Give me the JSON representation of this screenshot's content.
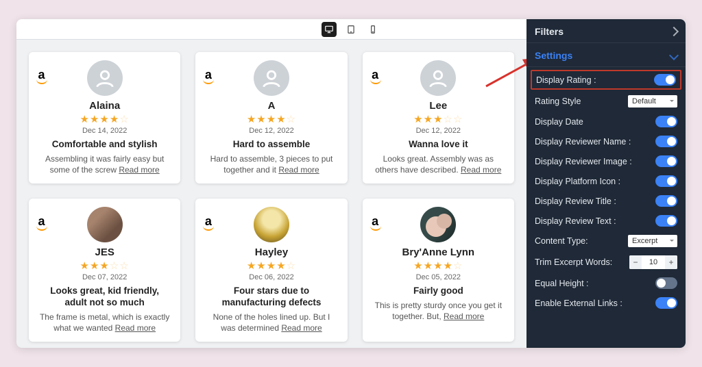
{
  "sidebar": {
    "filters_label": "Filters",
    "settings_label": "Settings",
    "display_rating_label": "Display Rating :",
    "rating_style_label": "Rating Style",
    "rating_style_value": "Default",
    "display_date_label": "Display Date",
    "display_reviewer_name_label": "Display Reviewer Name :",
    "display_reviewer_image_label": "Display Reviewer Image :",
    "display_platform_icon_label": "Display Platform Icon :",
    "display_review_title_label": "Display Review Title :",
    "display_review_text_label": "Display Review Text :",
    "content_type_label": "Content Type:",
    "content_type_value": "Excerpt",
    "trim_words_label": "Trim Excerpt Words:",
    "trim_words_value": "10",
    "equal_height_label": "Equal Height :",
    "enable_links_label": "Enable External Links :"
  },
  "read_more": "Read more",
  "reviews": [
    {
      "name": "Alaina",
      "stars": 4,
      "date": "Dec 14, 2022",
      "title": "Comfortable and stylish",
      "text": "Assembling it was fairly easy but some of the screw ",
      "avatar": "placeholder"
    },
    {
      "name": "A",
      "stars": 4,
      "date": "Dec 12, 2022",
      "title": "Hard to assemble",
      "text": "Hard to assemble, 3 pieces to put together and it ",
      "avatar": "placeholder"
    },
    {
      "name": "Lee",
      "stars": 3,
      "date": "Dec 12, 2022",
      "title": "Wanna love it",
      "text": "Looks great. Assembly was as others have described.  ",
      "avatar": "placeholder"
    },
    {
      "name": "JES",
      "stars": 3,
      "date": "Dec 07, 2022",
      "title": "Looks great, kid friendly, adult not so much",
      "text": "The frame is metal, which is exactly what we wanted ",
      "avatar": "photo1"
    },
    {
      "name": "Hayley",
      "stars": 4,
      "date": "Dec 06, 2022",
      "title": "Four stars due to manufacturing defects",
      "text": "None of the holes lined up. But I was determined ",
      "avatar": "photo2"
    },
    {
      "name": "Bry'Anne Lynn",
      "stars": 4,
      "date": "Dec 05, 2022",
      "title": "Fairly good",
      "text": "This is pretty sturdy once you get it together. But, ",
      "avatar": "photo3"
    }
  ]
}
